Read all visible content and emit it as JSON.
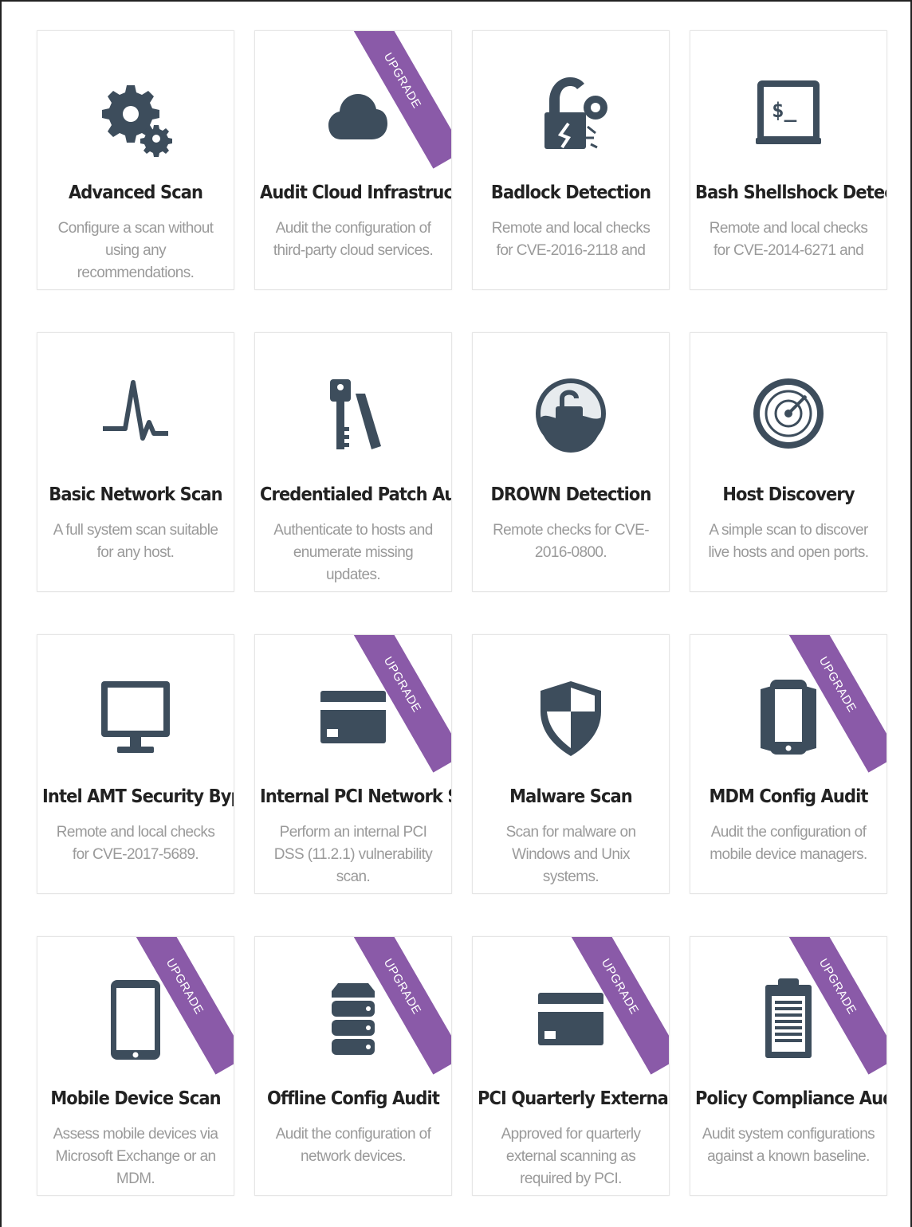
{
  "colors": {
    "icon": "#3d4d5c",
    "ribbon": "#8a5aa8",
    "title": "#222222",
    "description": "#9a9a9a"
  },
  "templates": [
    {
      "title": "Advanced Scan",
      "description": "Configure a scan without using any recommendations.",
      "icon": "gears-icon",
      "badge": ""
    },
    {
      "title": "Audit Cloud Infrastructure",
      "description": "Audit the configuration of third-party cloud services.",
      "icon": "cloud-icon",
      "badge": "UPGRADE"
    },
    {
      "title": "Badlock Detection",
      "description": "Remote and local checks for CVE-2016-2118 and",
      "icon": "broken-lock-icon",
      "badge": ""
    },
    {
      "title": "Bash Shellshock Detection",
      "description": "Remote and local checks for CVE-2014-6271 and",
      "icon": "terminal-icon",
      "badge": ""
    },
    {
      "title": "Basic Network Scan",
      "description": "A full system scan suitable for any host.",
      "icon": "pulse-icon",
      "badge": ""
    },
    {
      "title": "Credentialed Patch Audit",
      "description": "Authenticate to hosts and enumerate missing updates.",
      "icon": "key-icon",
      "badge": ""
    },
    {
      "title": "DROWN Detection",
      "description": "Remote checks for CVE-2016-0800.",
      "icon": "drown-lock-icon",
      "badge": ""
    },
    {
      "title": "Host Discovery",
      "description": "A simple scan to discover live hosts and open ports.",
      "icon": "radar-icon",
      "badge": ""
    },
    {
      "title": "Intel AMT Security Bypass",
      "description": "Remote and local checks for CVE-2017-5689.",
      "icon": "monitor-icon",
      "badge": ""
    },
    {
      "title": "Internal PCI Network Scan",
      "description": "Perform an internal PCI DSS (11.2.1) vulnerability scan.",
      "icon": "credit-card-icon",
      "badge": "UPGRADE"
    },
    {
      "title": "Malware Scan",
      "description": "Scan for malware on Windows and Unix systems.",
      "icon": "shield-icon",
      "badge": ""
    },
    {
      "title": "MDM Config Audit",
      "description": "Audit the configuration of mobile device managers.",
      "icon": "phone-icon",
      "badge": "UPGRADE"
    },
    {
      "title": "Mobile Device Scan",
      "description": "Assess mobile devices via Microsoft Exchange or an MDM.",
      "icon": "tablet-icon",
      "badge": "UPGRADE"
    },
    {
      "title": "Offline Config Audit",
      "description": "Audit the configuration of network devices.",
      "icon": "server-stack-icon",
      "badge": "UPGRADE"
    },
    {
      "title": "PCI Quarterly External Scan",
      "description": "Approved for quarterly external scanning as required by PCI.",
      "icon": "credit-card-icon",
      "badge": "UPGRADE"
    },
    {
      "title": "Policy Compliance Auditing",
      "description": "Audit system configurations against a known baseline.",
      "icon": "clipboard-icon",
      "badge": "UPGRADE"
    }
  ]
}
